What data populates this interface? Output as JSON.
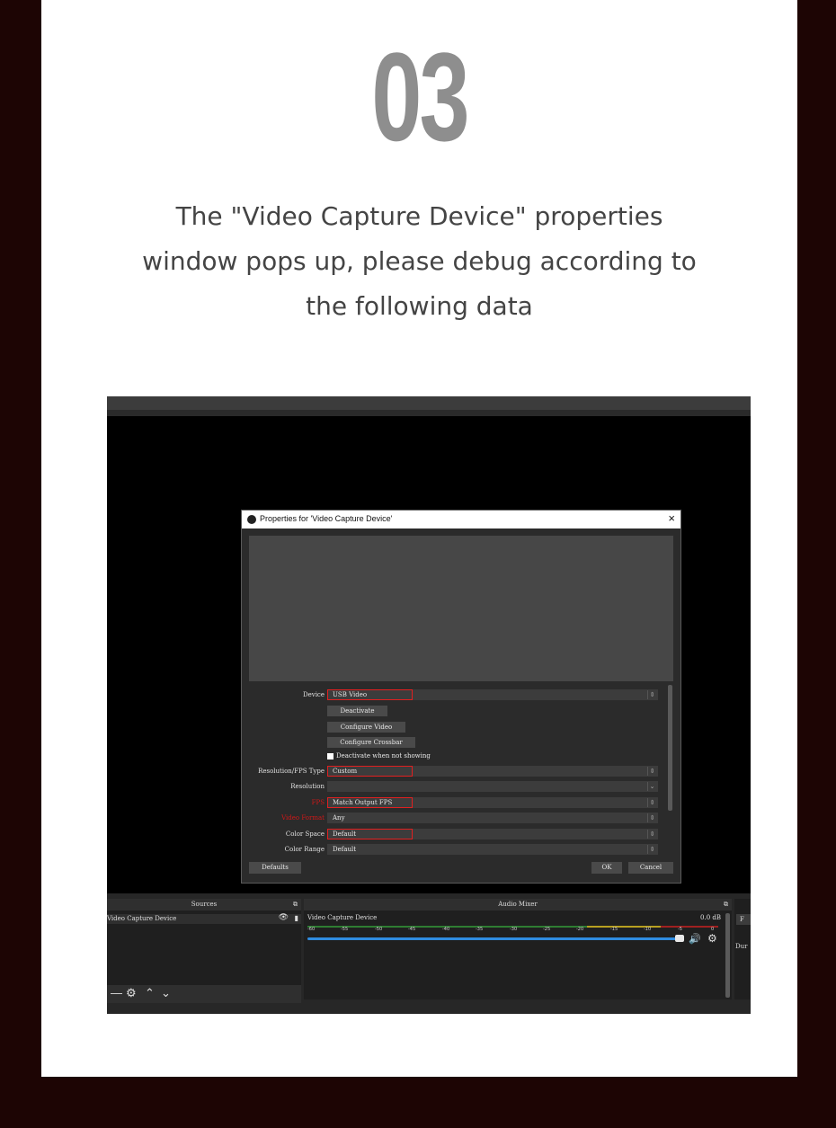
{
  "step": {
    "number": "03"
  },
  "description": {
    "line1": "The \"Video Capture Device\" properties",
    "line2": "window pops up, please debug according to",
    "line3": "the following data"
  },
  "dialog": {
    "title": "Properties for 'Video Capture Device'",
    "close_icon": "×",
    "fields": {
      "device": {
        "label": "Device",
        "value": "USB Video"
      },
      "deactivate": "Deactivate",
      "configure_video": "Configure Video",
      "configure_crossbar": "Configure Crossbar",
      "deactivate_when_not_showing": "Deactivate when not showing",
      "res_type": {
        "label": "Resolution/FPS Type",
        "value": "Custom"
      },
      "resolution": {
        "label": "Resolution",
        "value": ""
      },
      "fps": {
        "label": "FPS",
        "value": "Match Output FPS"
      },
      "video_format": {
        "label": "Video Format",
        "value": "Any"
      },
      "color_space": {
        "label": "Color Space",
        "value": "Default"
      },
      "color_range": {
        "label": "Color Range",
        "value": "Default"
      }
    },
    "buttons": {
      "defaults": "Defaults",
      "ok": "OK",
      "cancel": "Cancel"
    }
  },
  "sources": {
    "header": "Sources",
    "item": "Video Capture Device",
    "tools": [
      "—",
      "⚙",
      "⌃",
      "⌄"
    ]
  },
  "mixer": {
    "header": "Audio Mixer",
    "channel": "Video Capture Device",
    "db": "0.0 dB",
    "scale": [
      "-60",
      "-55",
      "-50",
      "-45",
      "-40",
      "-35",
      "-30",
      "-25",
      "-20",
      "-15",
      "-10",
      "-5",
      "0"
    ],
    "volume": 1.0
  },
  "right_panel": {
    "label_f": "F",
    "label_dur": "Dur"
  },
  "colors": {
    "highlight": "#e02020",
    "volume_bar": "#2f8ce0",
    "page_bg": "#1d0504"
  }
}
